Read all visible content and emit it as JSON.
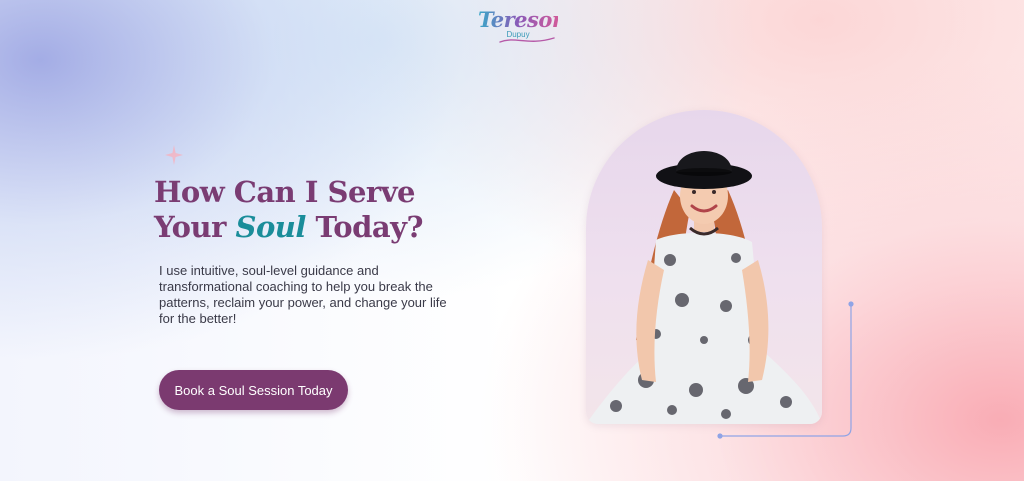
{
  "header": {
    "logo_main": "Tereson",
    "logo_sub": "Dupuy"
  },
  "hero": {
    "headline_line1": "How Can I Serve",
    "headline_your": "Your",
    "headline_soul": "Soul",
    "headline_today": "Today?",
    "intro_text": "I use intuitive, soul-level guidance and transformational coaching to help you break the patterns, reclaim your power, and change your life for the better!",
    "cta_label": "Book a Soul Session Today"
  },
  "portrait": {
    "alt": "Tereson Dupuy portrait"
  },
  "colors": {
    "brand_purple": "#7b3a70",
    "headline_purple": "#7a3c73",
    "accent_teal": "#1a8d9a",
    "deco_line": "#8fa4e6"
  },
  "icons": {
    "sparkle": "sparkle-icon"
  }
}
